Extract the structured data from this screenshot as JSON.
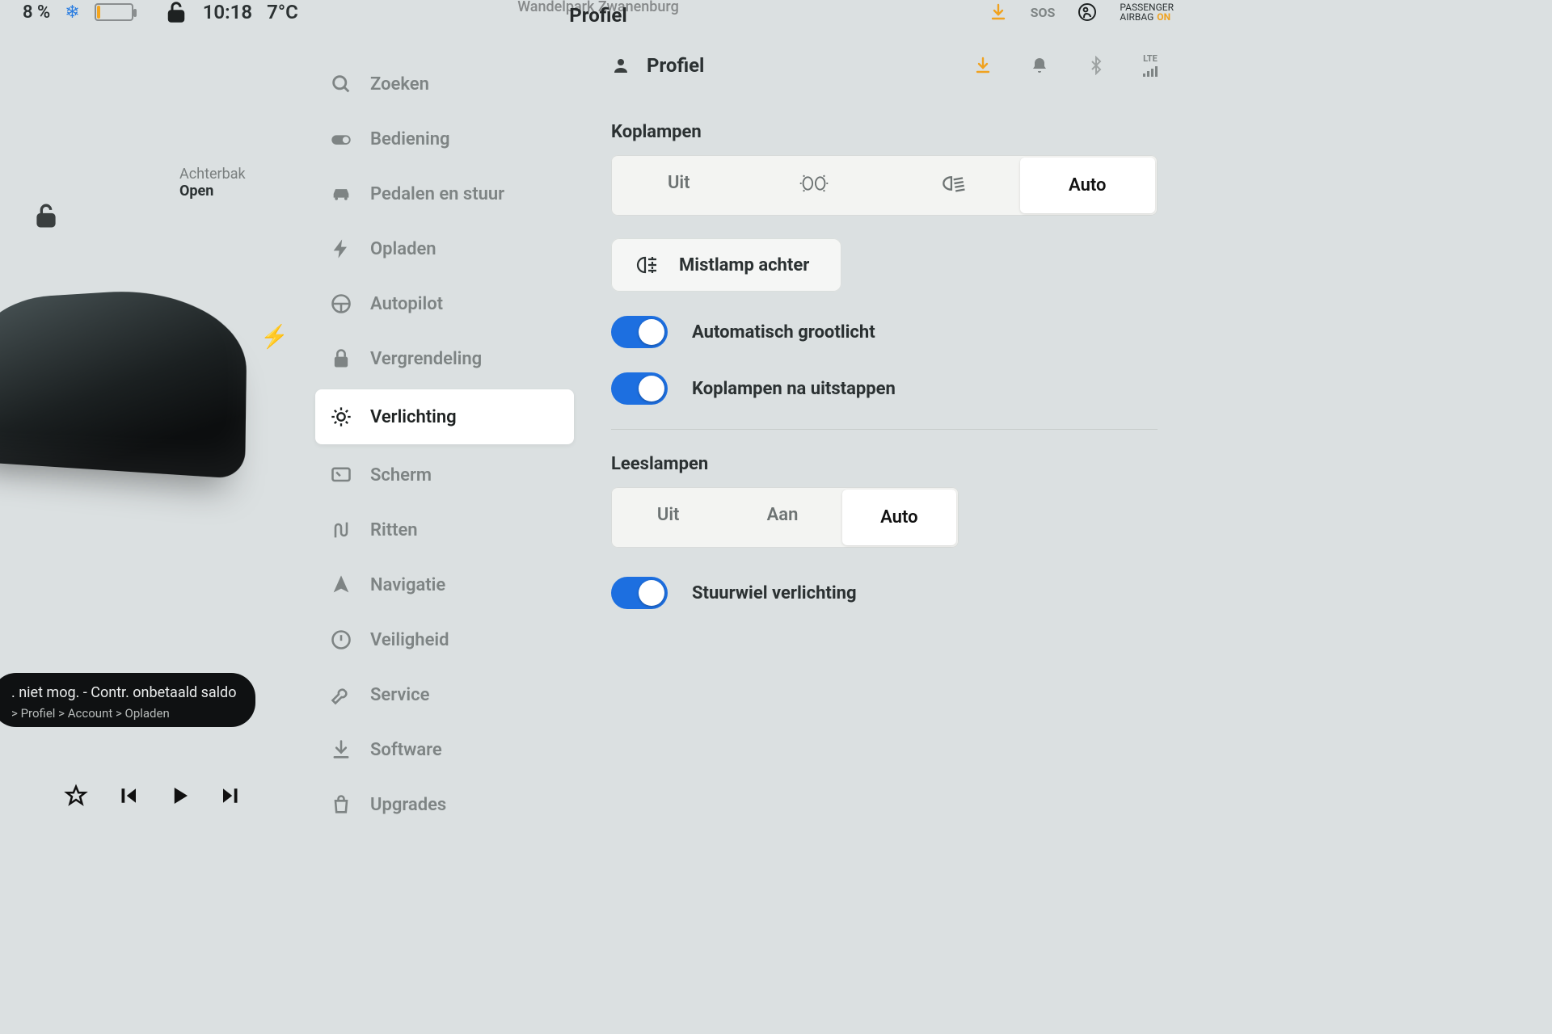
{
  "statusbar": {
    "battery_pct": "8 %",
    "time": "10:18",
    "temp": "7°C",
    "location": "Wandelpark Zwanenburg",
    "title": "Profiel",
    "sos": "SOS",
    "airbag_line1": "PASSENGER",
    "airbag_line2": "AIRBAG",
    "airbag_state": "ON",
    "lte": "LTE"
  },
  "left": {
    "trunk_label": "Achterbak",
    "trunk_state": "Open",
    "toast_line1": ". niet mog. - Contr. onbetaald saldo",
    "toast_crumbs": "> Profiel > Account > Opladen"
  },
  "menu": {
    "search": "Zoeken",
    "items": [
      {
        "label": "Bediening"
      },
      {
        "label": "Pedalen en stuur"
      },
      {
        "label": "Opladen"
      },
      {
        "label": "Autopilot"
      },
      {
        "label": "Vergrendeling"
      },
      {
        "label": "Verlichting"
      },
      {
        "label": "Scherm"
      },
      {
        "label": "Ritten"
      },
      {
        "label": "Navigatie"
      },
      {
        "label": "Veiligheid"
      },
      {
        "label": "Service"
      },
      {
        "label": "Software"
      },
      {
        "label": "Upgrades"
      }
    ]
  },
  "content": {
    "profile_label": "Profiel",
    "headlights": {
      "title": "Koplampen",
      "off": "Uit",
      "auto": "Auto"
    },
    "fog_rear": "Mistlamp achter",
    "auto_high_beam": "Automatisch grootlicht",
    "after_exit": "Koplampen na uitstappen",
    "reading": {
      "title": "Leeslampen",
      "off": "Uit",
      "on": "Aan",
      "auto": "Auto"
    },
    "steering_light": "Stuurwiel verlichting"
  }
}
